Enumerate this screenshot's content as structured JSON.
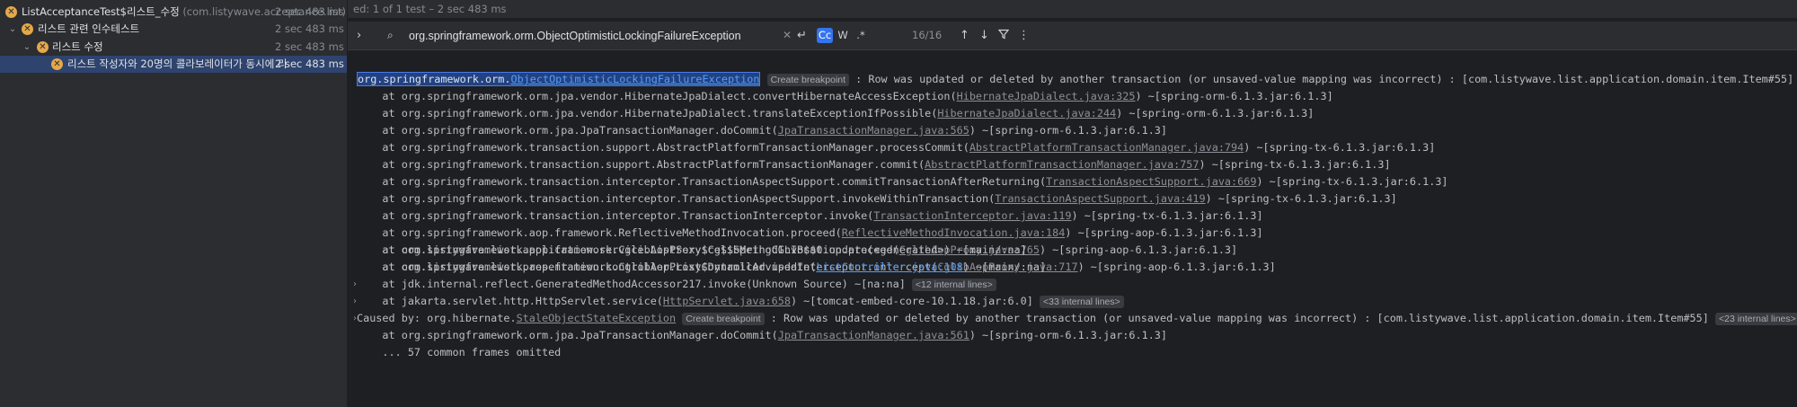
{
  "tree": {
    "root": {
      "name": "ListAcceptanceTest$리스트_수정",
      "pkg": "(com.listywave.acceptance.list)",
      "duration": "2 sec 483 ms"
    },
    "group": {
      "name": "리스트 관련 인수테스트",
      "duration": "2 sec 483 ms"
    },
    "subgroup": {
      "name": "리스트 수정",
      "duration": "2 sec 483 ms"
    },
    "test": {
      "name": "리스트 작성자와 20명의 콜라보레이터가 동시에 리",
      "duration": "2 sec 483 ms"
    }
  },
  "status": {
    "text": "ed: 1 of 1 test – 2 sec 483 ms"
  },
  "search": {
    "value": "org.springframework.orm.ObjectOptimisticLockingFailureException",
    "match_count": "16/16",
    "opt_case": "Cc",
    "opt_word": "W",
    "opt_regex": ".*"
  },
  "console": {
    "create_bp": "Create breakpoint",
    "l0_pkg": "org.springframework.orm.",
    "l0_cls": "ObjectOptimisticLockingFailureException",
    "l0_rest": " : Row was updated or deleted by another transaction (or unsaved-value mapping was incorrect) : [com.listywave.list.application.domain.item.Item#55]",
    "frames": [
      {
        "pre": "    at org.springframework.orm.jpa.vendor.HibernateJpaDialect.convertHibernateAccessException(",
        "link": "HibernateJpaDialect.java:325",
        "post": ") ~[spring-orm-6.1.3.jar:6.1.3]"
      },
      {
        "pre": "    at org.springframework.orm.jpa.vendor.HibernateJpaDialect.translateExceptionIfPossible(",
        "link": "HibernateJpaDialect.java:244",
        "post": ") ~[spring-orm-6.1.3.jar:6.1.3]"
      },
      {
        "pre": "    at org.springframework.orm.jpa.JpaTransactionManager.doCommit(",
        "link": "JpaTransactionManager.java:565",
        "post": ") ~[spring-orm-6.1.3.jar:6.1.3]"
      },
      {
        "pre": "    at org.springframework.transaction.support.AbstractPlatformTransactionManager.processCommit(",
        "link": "AbstractPlatformTransactionManager.java:794",
        "post": ") ~[spring-tx-6.1.3.jar:6.1.3]"
      },
      {
        "pre": "    at org.springframework.transaction.support.AbstractPlatformTransactionManager.commit(",
        "link": "AbstractPlatformTransactionManager.java:757",
        "post": ") ~[spring-tx-6.1.3.jar:6.1.3]"
      },
      {
        "pre": "    at org.springframework.transaction.interceptor.TransactionAspectSupport.commitTransactionAfterReturning(",
        "link": "TransactionAspectSupport.java:669",
        "post": ") ~[spring-tx-6.1.3.jar:6.1.3]"
      },
      {
        "pre": "    at org.springframework.transaction.interceptor.TransactionAspectSupport.invokeWithinTransaction(",
        "link": "TransactionAspectSupport.java:419",
        "post": ") ~[spring-tx-6.1.3.jar:6.1.3]"
      },
      {
        "pre": "    at org.springframework.transaction.interceptor.TransactionInterceptor.invoke(",
        "link": "TransactionInterceptor.java:119",
        "post": ") ~[spring-tx-6.1.3.jar:6.1.3]"
      },
      {
        "pre": "    at org.springframework.aop.framework.ReflectiveMethodInvocation.proceed(",
        "link": "ReflectiveMethodInvocation.java:184",
        "post": ") ~[spring-aop-6.1.3.jar:6.1.3]"
      },
      {
        "pre": "    at org.springframework.aop.framework.CglibAopProxy$CglibMethodInvocation.proceed(",
        "link": "CglibAopProxy.java:765",
        "post": ") ~[spring-aop-6.1.3.jar:6.1.3]"
      },
      {
        "pre": "    at org.springframework.aop.framework.CglibAopProxy$DynamicAdvisedInterceptor.intercept(",
        "link": "CglibAopProxy.java:717",
        "post": ") ~[spring-aop-6.1.3.jar:6.1.3]"
      }
    ],
    "l12": "    at com.listywave.list.application.service.ListService$$SpringCGLIB$$0.update(<generated>) ~[main/:na]",
    "l13_pre": "    at com.listywave.list.presentation.controller.ListController.update(",
    "l13_link": "ListController.java:108",
    "l13_post": ") ~[main/:na]",
    "l14_text": "    at jdk.internal.reflect.GeneratedMethodAccessor217.invoke(Unknown Source) ~[na:na]",
    "l14_chip": "<12 internal lines>",
    "l15_pre": "    at jakarta.servlet.http.HttpServlet.service(",
    "l15_link": "HttpServlet.java:658",
    "l15_post": ") ~[tomcat-embed-core-10.1.18.jar:6.0]",
    "l15_chip": "<33 internal lines>",
    "l16_pre": "Caused by: org.hibernate.",
    "l16_cls": "StaleObjectStateException",
    "l16_post": " : Row was updated or deleted by another transaction (or unsaved-value mapping was incorrect) : [com.listywave.list.application.domain.item.Item#55]",
    "l16_chip": "<23 internal lines>",
    "l17_pre": "    at org.springframework.orm.jpa.JpaTransactionManager.doCommit(",
    "l17_link": "JpaTransactionManager.java:561",
    "l17_post": ") ~[spring-orm-6.1.3.jar:6.1.3]",
    "l18": "    ... 57 common frames omitted"
  }
}
